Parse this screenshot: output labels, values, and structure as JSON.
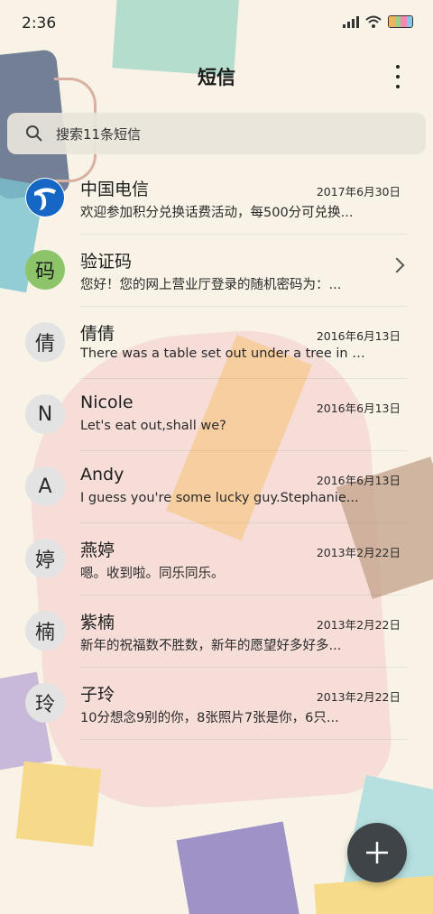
{
  "status_bar": {
    "time": "2:36",
    "icons": [
      "signal-icon",
      "wifi-icon",
      "battery-icon"
    ]
  },
  "header": {
    "title": "短信",
    "menu_icon": "more-vertical-icon"
  },
  "search": {
    "placeholder": "搜索11条短信",
    "icon": "search-icon"
  },
  "messages": [
    {
      "avatar": "",
      "avatar_type": "logo",
      "name": "中国电信",
      "date": "2017年6月30日",
      "preview": "欢迎参加积分兑换话费活动，每500分可兑换..."
    },
    {
      "avatar": "码",
      "avatar_type": "green",
      "name": "验证码",
      "date": "",
      "preview": "您好！您的网上营业厅登录的随机密码为：...",
      "has_chevron": true
    },
    {
      "avatar": "倩",
      "avatar_type": "gray",
      "name": "倩倩",
      "date": "2016年6月13日",
      "preview": "There was a table set out under a tree in front..."
    },
    {
      "avatar": "N",
      "avatar_type": "gray",
      "name": "Nicole",
      "date": "2016年6月13日",
      "preview": "Let's eat out,shall we?"
    },
    {
      "avatar": "A",
      "avatar_type": "gray",
      "name": "Andy",
      "date": "2016年6月13日",
      "preview": "I guess you're some lucky guy.Stephanie..."
    },
    {
      "avatar": "婷",
      "avatar_type": "gray",
      "name": "燕婷",
      "date": "2013年2月22日",
      "preview": "嗯。收到啦。同乐同乐。"
    },
    {
      "avatar": "楠",
      "avatar_type": "gray",
      "name": "紫楠",
      "date": "2013年2月22日",
      "preview": "新年的祝福数不胜数，新年的愿望好多好多..."
    },
    {
      "avatar": "玲",
      "avatar_type": "gray",
      "name": "子玲",
      "date": "2013年2月22日",
      "preview": "10分想念9别的你，8张照片7张是你，6只..."
    }
  ],
  "fab": {
    "icon": "plus-icon"
  },
  "colors": {
    "background": "#f8f3e6",
    "fab": "#3f4448",
    "avatar_green": "#8dc46a",
    "avatar_gray": "#e3e3e3",
    "telecom_blue": "#1666c5"
  }
}
